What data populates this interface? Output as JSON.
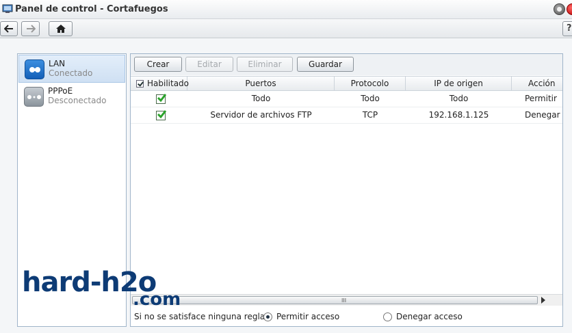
{
  "window": {
    "title": "Panel de control - Cortafuegos"
  },
  "navigation": {
    "back_icon": "arrow-left-icon",
    "forward_icon": "arrow-right-icon",
    "home_icon": "home-icon",
    "help_label": "?"
  },
  "interfaces": [
    {
      "name": "LAN",
      "status": "Conectado",
      "selected": true,
      "icon": "network-connected-icon"
    },
    {
      "name": "PPPoE",
      "status": "Desconectado",
      "selected": false,
      "icon": "network-disconnected-icon"
    }
  ],
  "toolbar": {
    "create_label": "Crear",
    "edit_label": "Editar",
    "delete_label": "Eliminar",
    "save_label": "Guardar"
  },
  "table": {
    "columns": [
      "Habilitado",
      "Puertos",
      "Protocolo",
      "IP de origen",
      "Acción"
    ],
    "rows": [
      {
        "enabled": true,
        "ports": "Todo",
        "protocol": "Todo",
        "source_ip": "Todo",
        "action": "Permitir"
      },
      {
        "enabled": true,
        "ports": "Servidor de archivos FTP",
        "protocol": "TCP",
        "source_ip": "192.168.1.125",
        "action": "Denegar"
      }
    ]
  },
  "scrollbar": {
    "grip": "III"
  },
  "default_policy": {
    "label": "Si no se satisface ninguna regla:",
    "options": [
      "Permitir acceso",
      "Denegar acceso"
    ],
    "selected": "Permitir acceso"
  },
  "watermark": {
    "line1": "hard-h2o",
    "line2": ".com"
  },
  "colors": {
    "accent": "#1460b8",
    "check_green": "#2aa32a",
    "watermark": "#0d3b75"
  }
}
